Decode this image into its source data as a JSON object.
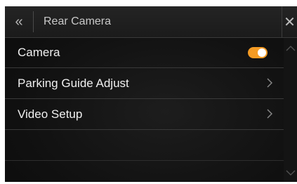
{
  "header": {
    "title": "Rear Camera",
    "back_icon": "double-chevron-left-icon",
    "close_icon": "close-icon"
  },
  "rows": [
    {
      "label": "Camera",
      "control": "toggle",
      "toggle_on": true
    },
    {
      "label": "Parking Guide Adjust",
      "control": "chevron",
      "icon": "chevron-right-icon"
    },
    {
      "label": "Video Setup",
      "control": "chevron",
      "icon": "chevron-right-icon"
    }
  ],
  "scrollbar": {
    "up_icon": "chevron-up-icon",
    "down_icon": "chevron-down-icon"
  },
  "colors": {
    "accent": "#f49b24",
    "background": "#111111",
    "text": "#f0f0f0",
    "divider": "#3a3a3a"
  }
}
